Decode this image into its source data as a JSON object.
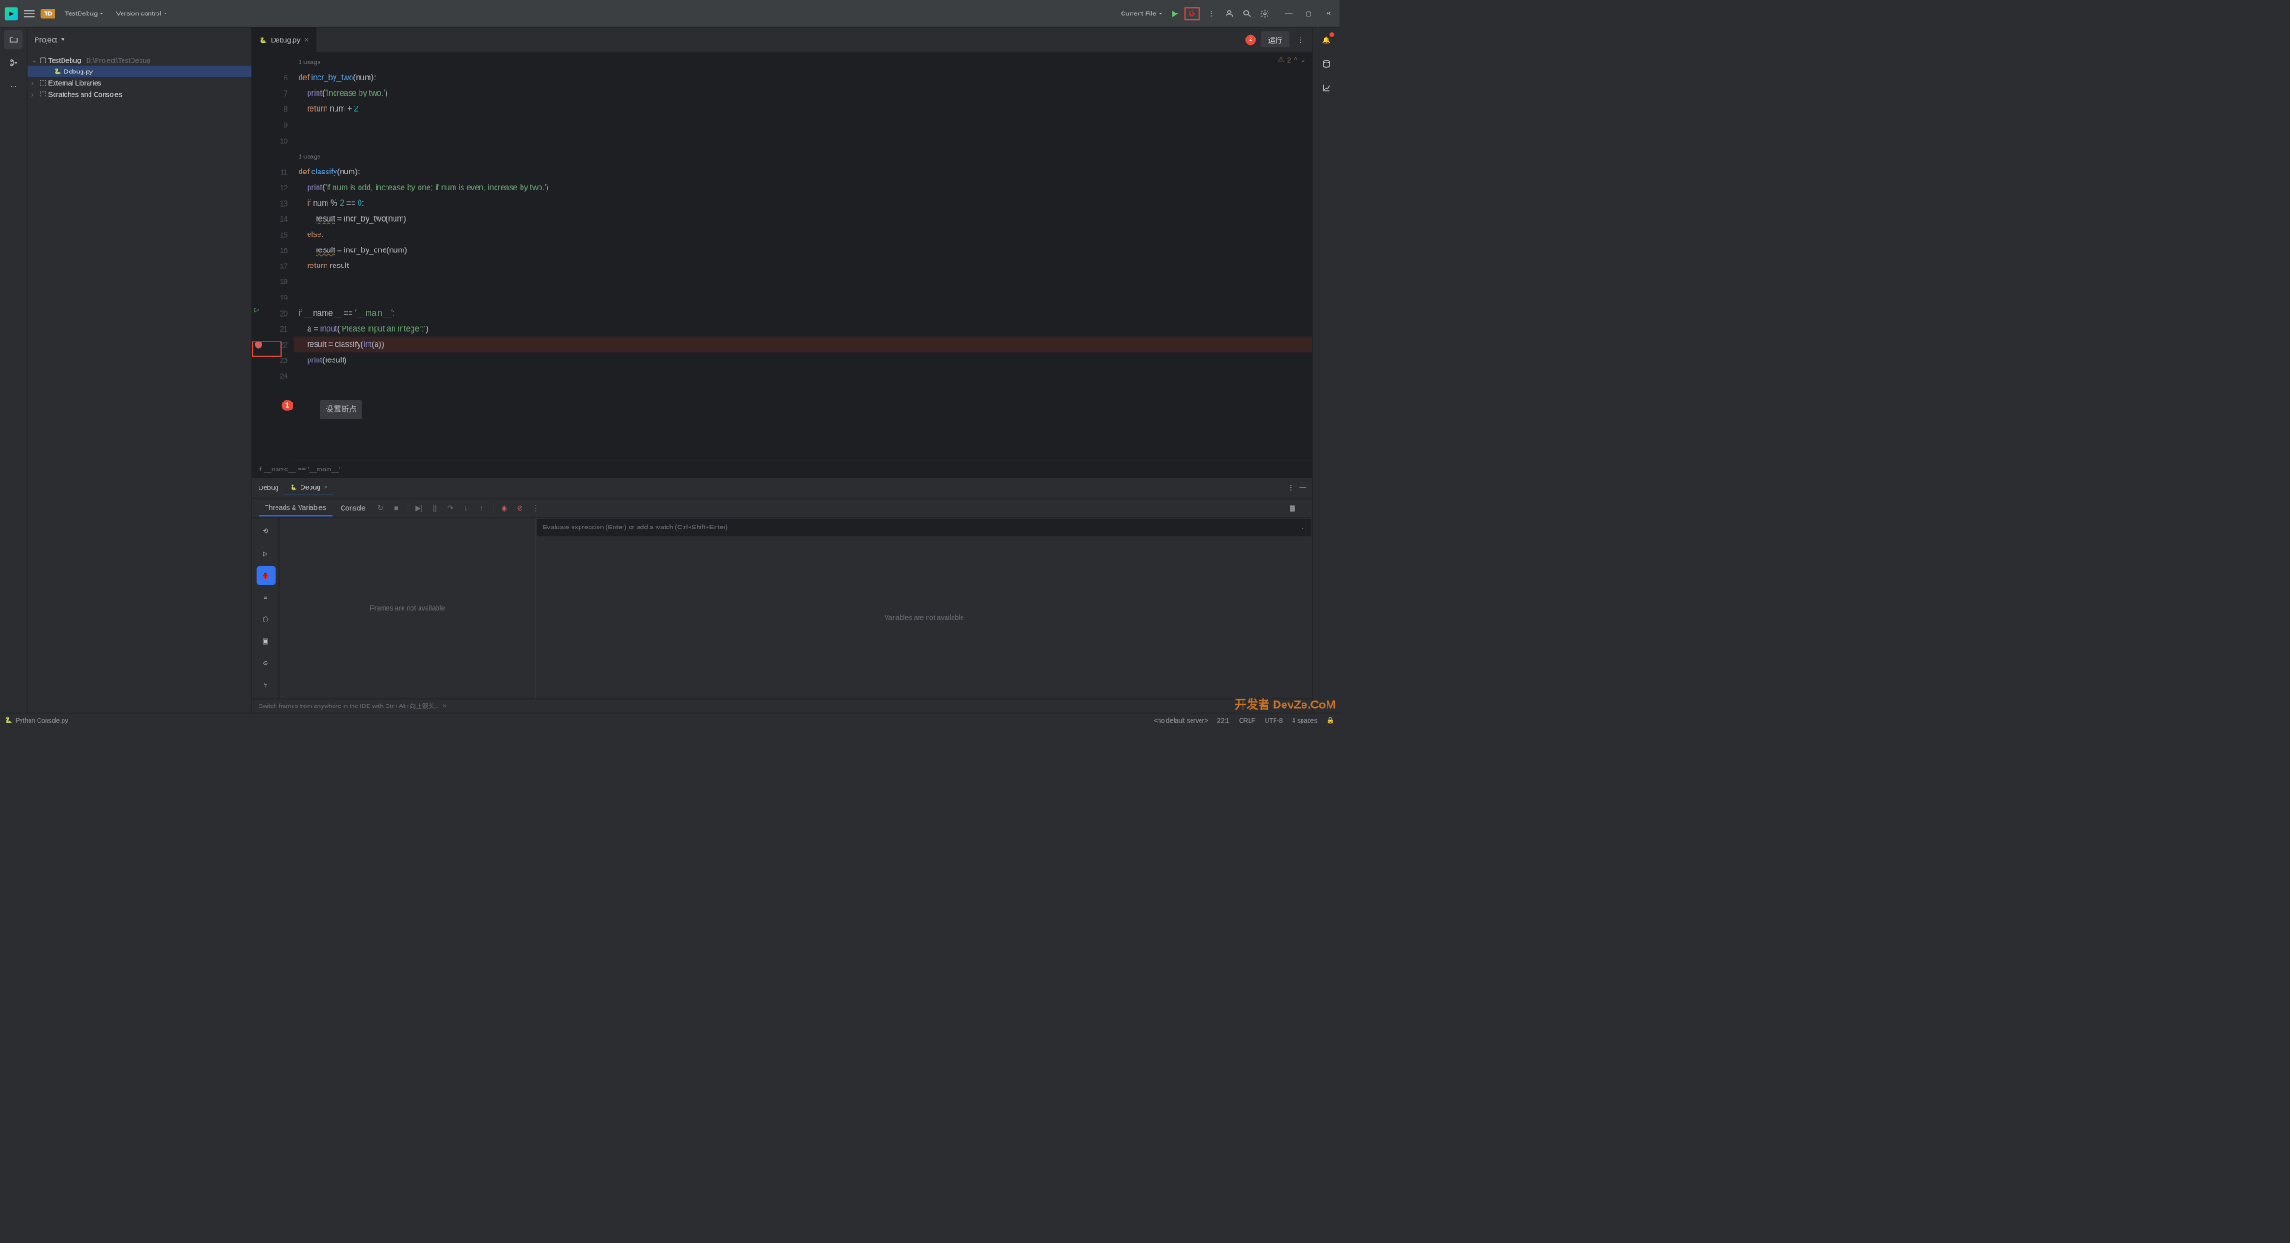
{
  "titlebar": {
    "project_badge": "TD",
    "project_name": "TestDebug",
    "vcs": "Version control",
    "run_config": "Current File",
    "tooltip_badge": "2",
    "tooltip_text": "运行"
  },
  "project": {
    "header": "Project",
    "root": "TestDebug",
    "root_path": "D:\\Project\\TestDebug",
    "file": "Debug.py",
    "external": "External Libraries",
    "scratches": "Scratches and Consoles"
  },
  "tab": {
    "filename": "Debug.py"
  },
  "editor": {
    "warnings_count": "2",
    "usage1": "1 usage",
    "usage2": "1 usage",
    "line6": {
      "def": "def ",
      "fn": "incr_by_two",
      "rest": "(num):"
    },
    "line7": {
      "builtin": "print",
      "str": "'Increase by two.'"
    },
    "line8": {
      "ret": "return ",
      "var": "num + ",
      "num": "2"
    },
    "line11": {
      "def": "def ",
      "fn": "classify",
      "rest": "(num):"
    },
    "line12": {
      "builtin": "print",
      "str": "'if num is odd, increase by one; if num is even, increase by two.'"
    },
    "line13": {
      "if": "if ",
      "expr": "num % ",
      "num2": "2",
      "eq": " == ",
      "zero": "0",
      "colon": ":"
    },
    "line14": {
      "var": "result",
      "rest": " = incr_by_two(num)"
    },
    "line15": {
      "else": "else",
      "colon": ":"
    },
    "line16": {
      "var": "result",
      "rest": " = incr_by_one(num)"
    },
    "line17": {
      "ret": "return ",
      "var": "result"
    },
    "line20": {
      "if": "if ",
      "name": "__name__",
      "eq": " == ",
      "str": "'__main__'",
      "colon": ":"
    },
    "line21": {
      "var": "a = ",
      "builtin": "input",
      "str": "'Please input an integer:'"
    },
    "line22": {
      "var": "result = classify(",
      "builtin": "int",
      "rest": "(a))"
    },
    "line23": {
      "builtin": "print",
      "rest": "(result)"
    },
    "annotation1_num": "1",
    "annotation1_text": "设置断点",
    "breadcrumb": "if __name__ == '__main__'"
  },
  "debug": {
    "title": "Debug",
    "tab_label": "Debug",
    "tv_tab": "Threads & Variables",
    "console_tab": "Console",
    "frames_empty": "Frames are not available",
    "vars_empty": "Variables are not available",
    "eval_placeholder": "Evaluate expression (Enter) or add a watch (Ctrl+Shift+Enter)",
    "hint": "Switch frames from anywhere in the IDE with Ctrl+Alt+向上箭头.."
  },
  "statusbar": {
    "console": "Python Console.py",
    "server": "<no default server>",
    "pos": "22:1",
    "crlf": "CRLF",
    "encoding": "UTF-8",
    "indent": "4 spaces"
  },
  "watermark": "开发者 DevZe.CoM"
}
